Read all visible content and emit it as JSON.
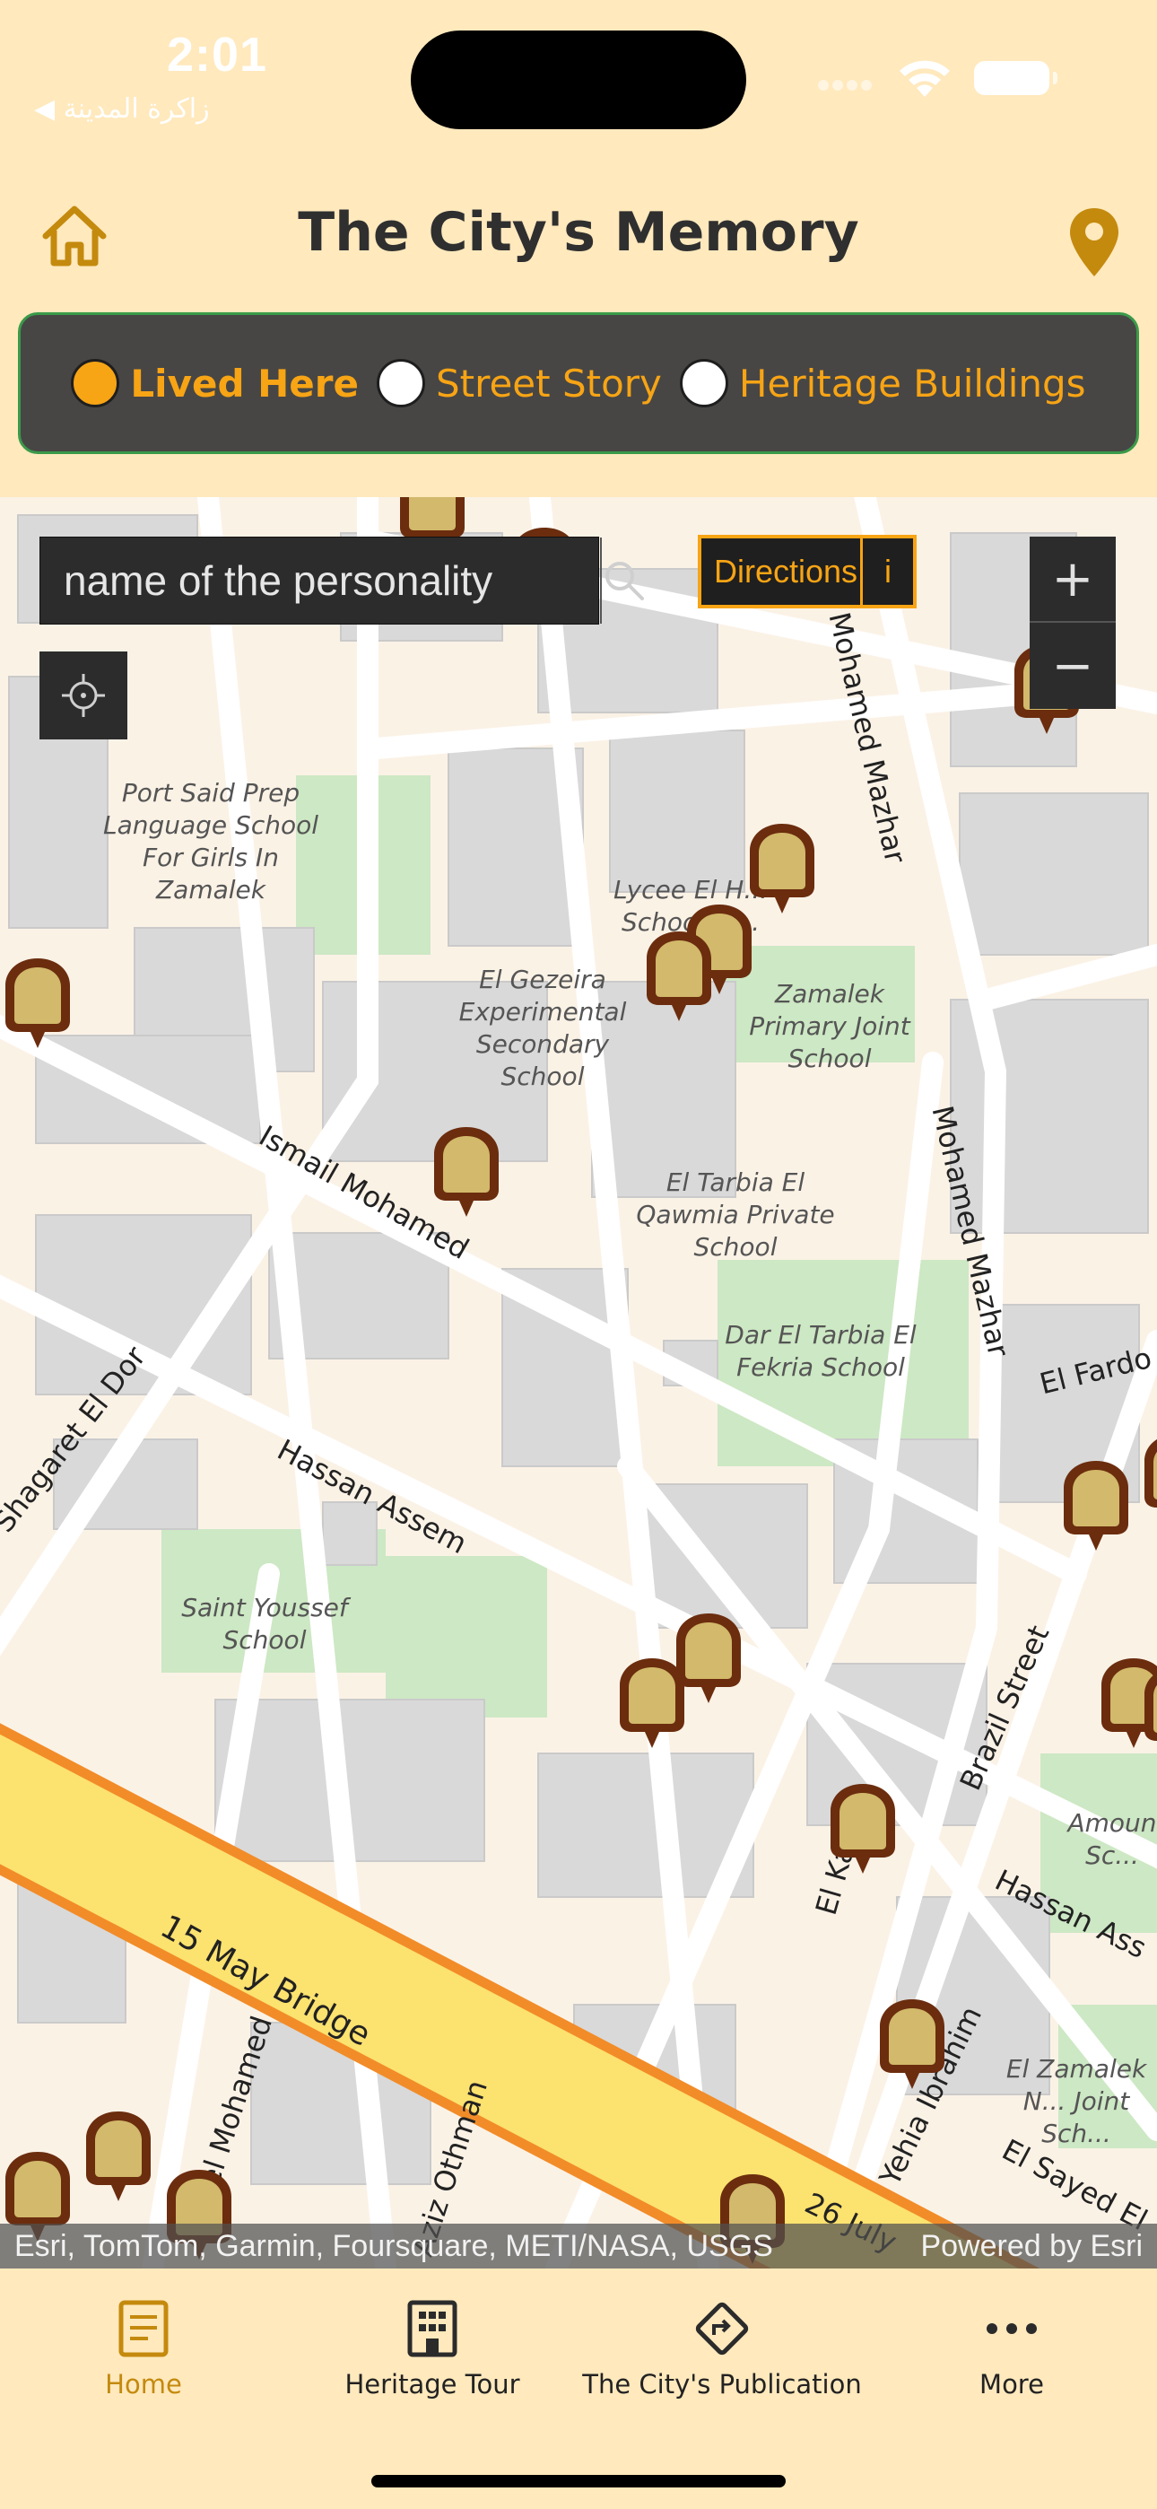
{
  "status_bar": {
    "time": "2:01",
    "back_app": "◀ زاكرة المدينة"
  },
  "header": {
    "title": "The City's Memory",
    "home_icon": "home-icon",
    "location_icon": "location-pin-icon"
  },
  "filter": {
    "options": [
      {
        "label": "Lived Here",
        "selected": true
      },
      {
        "label": "Street Story",
        "selected": false
      },
      {
        "label": "Heritage Buildings",
        "selected": false
      }
    ],
    "accent_color": "#F7A415"
  },
  "map": {
    "search_placeholder": "name of the personality",
    "directions_label": "Directions",
    "info_label": "i",
    "zoom_in": "+",
    "zoom_out": "−",
    "attribution": "Esri, TomTom, Garmin, Foursquare, METI/NASA, USGS",
    "powered_by": "Powered by Esri",
    "streets": [
      "Mohamed Mazhar",
      "Mohamed Mazhar",
      "Ismail Mohamed",
      "Shagaret El Dor",
      "Hassan Assem",
      "15 May Bridge",
      "Brazil Street",
      "Hassan Ass",
      "El Fardo",
      "Yehia Ibrahim",
      "Kamel Mohamed",
      "Aziz Othman",
      "26 July",
      "El Sayed El",
      "El Ka"
    ],
    "pois": [
      "Port Said Prep Language School For Girls In Zamalek",
      "Lycee El H... School El...",
      "El Gezeira Experimental Secondary School",
      "Zamalek Primary Joint School",
      "El Tarbia El Qawmia Private School",
      "Dar El Tarbia El Fekria School",
      "Saint Youssef School",
      "Amoun Sc...",
      "El Zamalek N... Joint Sch..."
    ]
  },
  "tabs": [
    {
      "label": "Home",
      "icon": "document-icon",
      "active": true
    },
    {
      "label": "Heritage Tour",
      "icon": "building-icon",
      "active": false
    },
    {
      "label": "The City's Publication",
      "icon": "directions-icon",
      "active": false
    },
    {
      "label": "More",
      "icon": "more-dots-icon",
      "active": false
    }
  ],
  "colors": {
    "background": "#FFE9BD",
    "panel": "#474645",
    "marker_fill": "#D2B96B",
    "marker_outline": "#6B2D0E",
    "active_tab": "#C48A0E"
  }
}
